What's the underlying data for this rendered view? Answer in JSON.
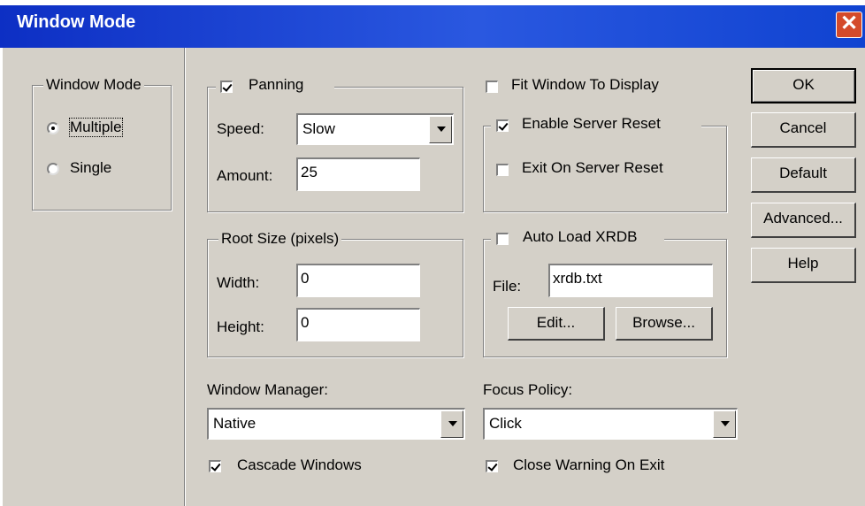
{
  "window": {
    "title": "Window Mode"
  },
  "window_mode": {
    "legend": "Window Mode",
    "options": [
      {
        "label": "Multiple",
        "selected": true
      },
      {
        "label": "Single",
        "selected": false
      }
    ]
  },
  "panning": {
    "label": "Panning",
    "checked": true,
    "speed_label": "Speed:",
    "speed_value": "Slow",
    "amount_label": "Amount:",
    "amount_value": "25"
  },
  "root_size": {
    "legend": "Root Size (pixels)",
    "width_label": "Width:",
    "width_value": "0",
    "height_label": "Height:",
    "height_value": "0"
  },
  "fit_window": {
    "label": "Fit Window To Display",
    "checked": false
  },
  "server_reset": {
    "label": "Enable Server Reset",
    "checked": true,
    "exit_label": "Exit On Server Reset",
    "exit_checked": false
  },
  "xrdb": {
    "label": "Auto Load XRDB",
    "checked": false,
    "file_label": "File:",
    "file_value": "xrdb.txt",
    "edit_button": "Edit...",
    "browse_button": "Browse..."
  },
  "window_manager": {
    "label": "Window Manager:",
    "value": "Native"
  },
  "focus_policy": {
    "label": "Focus Policy:",
    "value": "Click"
  },
  "cascade": {
    "label": "Cascade Windows",
    "checked": true
  },
  "close_warning": {
    "label": "Close Warning On Exit",
    "checked": true
  },
  "buttons": {
    "ok": "OK",
    "cancel": "Cancel",
    "default": "Default",
    "advanced": "Advanced...",
    "help": "Help"
  },
  "colors": {
    "titlebar": "#1043d1",
    "face": "#d4d0c8",
    "close": "#d44a2a"
  }
}
